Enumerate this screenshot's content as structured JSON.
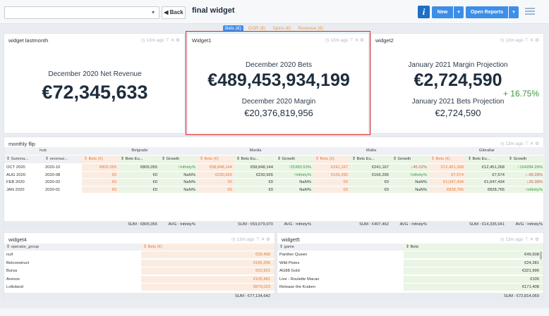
{
  "topbar": {
    "title": "final widget",
    "back_label": "Back",
    "info_label": "i",
    "new_label": "New",
    "open_reports_label": "Open Reports",
    "caret": "▾",
    "back_arrow": "◀"
  },
  "legend": [
    "Bets (€)",
    "GGR (€)",
    "Spins (€)",
    "Revenue (€)"
  ],
  "widget_lastmonth": {
    "title": "widget lastmonth",
    "meta": "◷ 13m ago  ⊤ ✕ ⚙",
    "label": "December 2020 Net Revenue",
    "value": "€72,345,633"
  },
  "widget1": {
    "title": "Widget1",
    "meta": "◷ 13m ago  ⊤ ✕ ⚙",
    "label1": "December 2020 Bets",
    "value1": "€489,453,934,199",
    "label2": "December 2020 Margin",
    "value2": "€20,376,819,956"
  },
  "widget2": {
    "title": "widget2",
    "meta": "◷ 13m ago  ⊤ ✕ ⚙",
    "label1": "January 2021 Margin Projection",
    "value1": "€2,724,590",
    "change": "+ 16.75%",
    "label2": "January 2021 Bets Projection",
    "value2": "€2,724,590"
  },
  "monthly_flip": {
    "title": "monthly flip",
    "meta": "◷ 13m ago  ⊤ ✕ ⚙",
    "group_hub": "hub",
    "groups": [
      "Belgrade",
      "Manila",
      "Malta",
      "Gibraltar"
    ],
    "sub_hub": [
      "⇕ Summa...",
      "⇕ revenue..."
    ],
    "sub_cols": [
      "⇕ Bets (€)",
      "⇕ Bets Eu...",
      "⇕ Growth"
    ],
    "rows": [
      {
        "summary": "OCT 2020",
        "revenue": "2020-10",
        "cells": [
          "€805,055",
          "€805,055",
          "↑Infinity%",
          "€58,848,144",
          "€58,848,144",
          "↑25383.53%",
          "€241,167",
          "€241,167",
          "↓45.02%",
          "€12,451,268",
          "€12,451,268",
          "↑164284.28%"
        ]
      },
      {
        "summary": "AUG 2020",
        "revenue": "2020-08",
        "cells": [
          "€0",
          "€0",
          "NaN%",
          "€230,926",
          "€230,926",
          "↑Infinity%",
          "€166,295",
          "€166,295",
          "↑Infinity%",
          "€7,574",
          "€7,574",
          "↓-99.28%"
        ]
      },
      {
        "summary": "FEB 2020",
        "revenue": "2020-02",
        "cells": [
          "€0",
          "€0",
          "NaN%",
          "€0",
          "€0",
          "NaN%",
          "€0",
          "€0",
          "NaN%",
          "€1,047,434",
          "€1,047,434",
          "↓26.38%"
        ]
      },
      {
        "summary": "JAN 2020",
        "revenue": "2020-01",
        "cells": [
          "€0",
          "€0",
          "NaN%",
          "€0",
          "€0",
          "NaN%",
          "€0",
          "€0",
          "NaN%",
          "€828,765",
          "€828,765",
          "↑Infinity%"
        ]
      }
    ],
    "footer": [
      "SUM : €805,055",
      "AVG : Infinity%",
      "SUM : €59,079,070",
      "AVG : Infinity%",
      "SUM : €407,462",
      "AVG : Infinity%",
      "SUM : €14,335,041",
      "AVG : Infinity%"
    ]
  },
  "widget4": {
    "title": "widget4",
    "meta": "◷ 13m ago  ⊤ ✕ ⚙",
    "col1": "⇕ operator_group",
    "col2": "⇕ Bets (€)",
    "rows": [
      {
        "name": "null",
        "value": "€39,456"
      },
      {
        "name": "Betconstruct",
        "value": "€166,295"
      },
      {
        "name": "Bursa",
        "value": "€33,921"
      },
      {
        "name": "Avexos",
        "value": "€105,481"
      },
      {
        "name": "Lottoland",
        "value": "€879,023"
      }
    ],
    "footer": "SUM : €77,134,642"
  },
  "widget5": {
    "title": "widget5",
    "meta": "◷ 13m ago  ⊤ ✕ ⚙",
    "col1": "⇕ game",
    "col2": "⇕ Bets",
    "rows": [
      {
        "name": "Panther Queen",
        "value": "€49,508"
      },
      {
        "name": "Wild Pixies",
        "value": "€24,281"
      },
      {
        "name": "AG88 Gold",
        "value": "€321,996"
      },
      {
        "name": "Live - Roulette Macao",
        "value": "€105"
      },
      {
        "name": "Release the Kraken",
        "value": "€171,408"
      }
    ],
    "footer": "SUM : €72,814,069"
  }
}
